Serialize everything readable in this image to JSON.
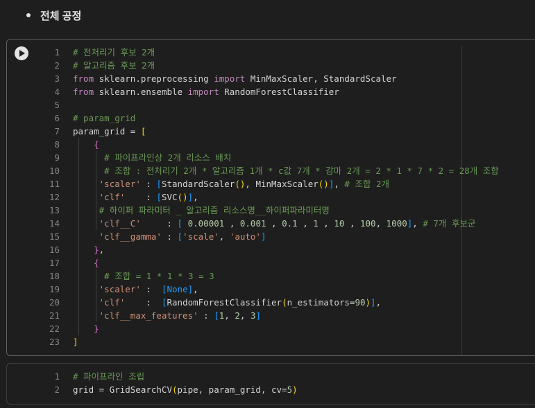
{
  "heading": "전체 공정",
  "cell1": {
    "lines": [
      {
        "n": "1",
        "html": "<span class=\"cmt\"># 전처리기 후보 2개</span>"
      },
      {
        "n": "2",
        "html": "<span class=\"cmt\"># 알고리즘 후보 2개</span>"
      },
      {
        "n": "3",
        "html": "<span class=\"kw\">from</span> sklearn.preprocessing <span class=\"kw\">import</span> MinMaxScaler, StandardScaler"
      },
      {
        "n": "4",
        "html": "<span class=\"kw\">from</span> sklearn.ensemble <span class=\"kw\">import</span> RandomForestClassifier"
      },
      {
        "n": "5",
        "html": ""
      },
      {
        "n": "6",
        "html": "<span class=\"cmt\"># param_grid</span>"
      },
      {
        "n": "7",
        "html": "param_grid = <span class=\"b1\">[</span>"
      },
      {
        "n": "8",
        "html": "    <span class=\"b2\">{</span>"
      },
      {
        "n": "9",
        "html": "      <span class=\"cmt\"># 파이프라인상 2개 리소스 배치</span>"
      },
      {
        "n": "10",
        "html": "      <span class=\"cmt\"># 조합 : 전처리기 2개 * 알고리즘 1개 * c값 7개 * 감마 2개 = 2 * 1 * 7 * 2 = 28개 조합</span>"
      },
      {
        "n": "11",
        "html": "     <span class=\"str\">'scaler'</span> : <span class=\"b3\">[</span>StandardScaler<span class=\"b1\">()</span>, MinMaxScaler<span class=\"b1\">()</span><span class=\"b3\">]</span>, <span class=\"cmt\"># 조합 2개</span>"
      },
      {
        "n": "12",
        "html": "     <span class=\"str\">'clf'</span>    : <span class=\"b3\">[</span>SVC<span class=\"b1\">()</span><span class=\"b3\">]</span>,"
      },
      {
        "n": "13",
        "html": "     <span class=\"cmt\"># 하이퍼 파라미터 _ 알고리즘 리소스명__하이퍼파라미터명</span>"
      },
      {
        "n": "14",
        "html": "     <span class=\"str\">'clf__C'</span>     : <span class=\"b3\">[</span> <span class=\"num\">0.00001</span> , <span class=\"num\">0.001</span> , <span class=\"num\">0.1</span> , <span class=\"num\">1</span> , <span class=\"num\">10</span> , <span class=\"num\">100</span>, <span class=\"num\">1000</span><span class=\"b3\">]</span>, <span class=\"cmt\"># 7개 후보군</span>"
      },
      {
        "n": "15",
        "html": "     <span class=\"str\">'clf__gamma'</span> : <span class=\"b3\">[</span><span class=\"str\">'scale'</span>, <span class=\"str\">'auto'</span><span class=\"b3\">]</span>"
      },
      {
        "n": "16",
        "html": "    <span class=\"b2\">}</span>,"
      },
      {
        "n": "17",
        "html": "    <span class=\"b2\">{</span>"
      },
      {
        "n": "18",
        "html": "      <span class=\"cmt\"># 조합 = 1 * 1 * 3 = 3</span>"
      },
      {
        "n": "19",
        "html": "     <span class=\"str\">'scaler'</span> :  <span class=\"b3\">[</span><span class=\"b3\">None</span><span class=\"b3\">]</span>,"
      },
      {
        "n": "20",
        "html": "     <span class=\"str\">'clf'</span>    :  <span class=\"b3\">[</span>RandomForestClassifier<span class=\"b1\">(</span>n_estimators=<span class=\"num\">90</span><span class=\"b1\">)</span><span class=\"b3\">]</span>,"
      },
      {
        "n": "21",
        "html": "     <span class=\"str\">'clf__max_features'</span> : <span class=\"b3\">[</span><span class=\"num\">1</span>, <span class=\"num\">2</span>, <span class=\"num\">3</span><span class=\"b3\">]</span>"
      },
      {
        "n": "22",
        "html": "    <span class=\"b2\">}</span>"
      },
      {
        "n": "23",
        "html": "<span class=\"b1\">]</span>"
      }
    ]
  },
  "cell2": {
    "lines": [
      {
        "n": "1",
        "html": "<span class=\"cmt\"># 파이프라인 조립</span>"
      },
      {
        "n": "2",
        "html": "grid = GridSearchCV<span class=\"b1\">(</span>pipe, param_grid, cv=<span class=\"num\">5</span><span class=\"b1\">)</span>"
      }
    ]
  }
}
